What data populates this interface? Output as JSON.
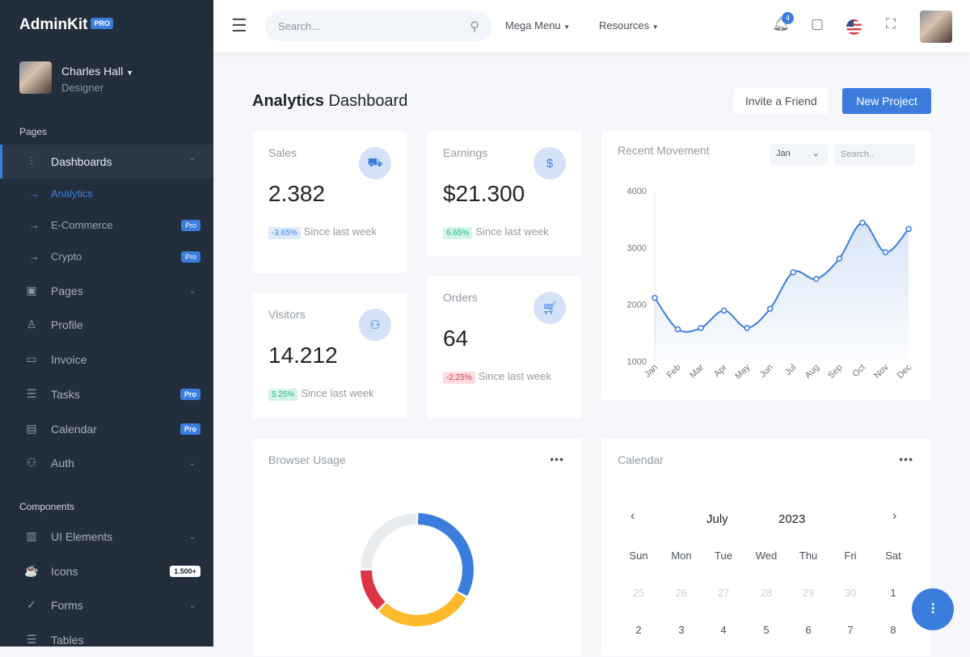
{
  "brand": {
    "name": "AdminKit",
    "badge": "PRO"
  },
  "user": {
    "name": "Charles Hall",
    "role": "Designer"
  },
  "sidebar": {
    "section_pages": "Pages",
    "section_components": "Components",
    "dashboards": "Dashboards",
    "sub": [
      {
        "label": "Analytics"
      },
      {
        "label": "E-Commerce",
        "badge": "Pro"
      },
      {
        "label": "Crypto",
        "badge": "Pro"
      }
    ],
    "items": [
      {
        "label": "Pages"
      },
      {
        "label": "Profile"
      },
      {
        "label": "Invoice"
      },
      {
        "label": "Tasks",
        "badge": "Pro"
      },
      {
        "label": "Calendar",
        "badge": "Pro"
      },
      {
        "label": "Auth"
      }
    ],
    "components": [
      {
        "label": "UI Elements"
      },
      {
        "label": "Icons",
        "badge": "1.500+"
      },
      {
        "label": "Forms"
      },
      {
        "label": "Tables"
      }
    ]
  },
  "topbar": {
    "search_placeholder": "Search...",
    "mega_menu": "Mega Menu",
    "resources": "Resources",
    "notifications_count": "4"
  },
  "page": {
    "title_bold": "Analytics",
    "title_rest": "Dashboard",
    "invite": "Invite a Friend",
    "new_project": "New Project"
  },
  "stats": [
    {
      "title": "Sales",
      "value": "2.382",
      "change": "-3.65%",
      "foot": "Since last week",
      "icon": "truck-icon"
    },
    {
      "title": "Earnings",
      "value": "$21.300",
      "change": "6.65%",
      "foot": "Since last week",
      "icon": "dollar-icon"
    },
    {
      "title": "Visitors",
      "value": "14.212",
      "change": "5.25%",
      "foot": "Since last week",
      "icon": "users-icon"
    },
    {
      "title": "Orders",
      "value": "64",
      "change": "-2.25%",
      "foot": "Since last week",
      "icon": "cart-icon"
    }
  ],
  "colors": {
    "primary": "#3b7ddd",
    "warning": "#fcb92c",
    "danger": "#dc3545",
    "gray": "#e9ecef",
    "sidebar": "#222e3c"
  },
  "chart_data": [
    {
      "type": "area",
      "title": "Recent Movement",
      "filter_month": "Jan",
      "search_placeholder": "Search..",
      "categories": [
        "Jan",
        "Feb",
        "Mar",
        "Apr",
        "May",
        "Jun",
        "Jul",
        "Aug",
        "Sep",
        "Oct",
        "Nov",
        "Dec"
      ],
      "values": [
        2115,
        1562,
        1584,
        1892,
        1587,
        1923,
        2566,
        2448,
        2805,
        3438,
        2917,
        3327
      ],
      "ylim": [
        1000,
        4000
      ],
      "yticks": [
        "4000",
        "3000",
        "2000",
        "1000"
      ],
      "grid": false
    },
    {
      "type": "pie",
      "title": "Browser Usage",
      "donut": true,
      "values": [
        4306,
        3801,
        1689,
        3251
      ],
      "colors": [
        "#3b7ddd",
        "#fcb92c",
        "#dc3545",
        "#e9ecef"
      ]
    }
  ],
  "calendar": {
    "title": "Calendar",
    "month": "July",
    "year": "2023",
    "weekdays": [
      "Sun",
      "Mon",
      "Tue",
      "Wed",
      "Thu",
      "Fri",
      "Sat"
    ],
    "rows": [
      [
        "25",
        "26",
        "27",
        "28",
        "29",
        "30",
        "1"
      ],
      [
        "2",
        "3",
        "4",
        "5",
        "6",
        "7",
        "8"
      ]
    ]
  }
}
